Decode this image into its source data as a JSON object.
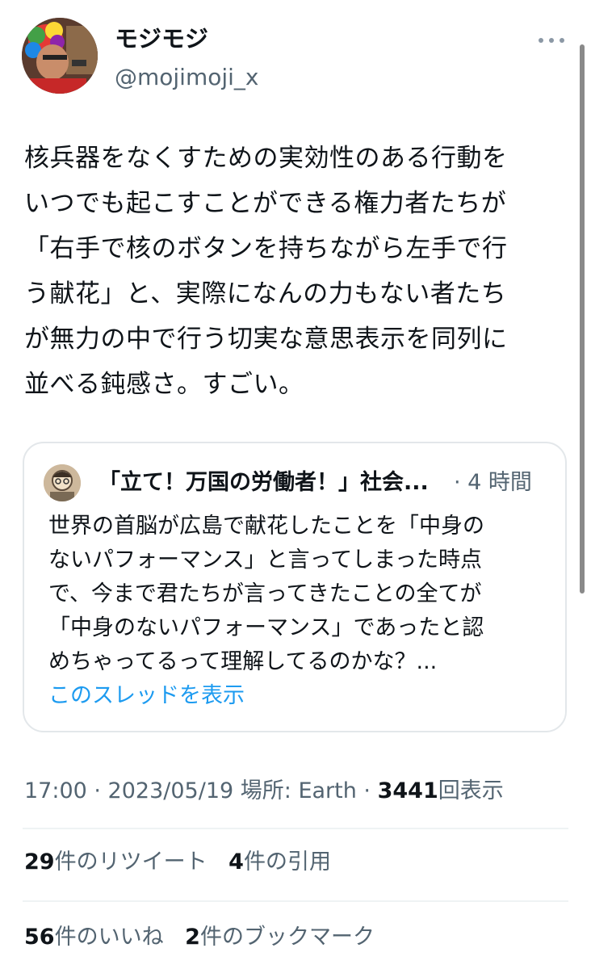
{
  "author": {
    "display_name": "モジモジ",
    "handle": "@mojimoji_x"
  },
  "tweet": {
    "lines": [
      "核兵器をなくすための実効性のある行動を",
      "いつでも起こすことができる権力者たちが",
      "「右手で核のボタンを持ちながら左手で行",
      "う献花」と、実際になんの力もない者たち",
      "が無力の中で行う切実な意思表示を同列に",
      "並べる鈍感さ。すごい。"
    ]
  },
  "quote": {
    "author_name": "「立て！万国の労働者！」社会...",
    "meta": "· 4 時間",
    "lines": [
      "世界の首脳が広島で献花したことを「中身の",
      "ないパフォーマンス」と言ってしまった時点",
      "で、今まで君たちが言ってきたことの全てが",
      "「中身のないパフォーマンス」であったと認",
      "めちゃってるって理解してるのかな？..."
    ],
    "show_thread": "このスレッドを表示"
  },
  "meta": {
    "time": "17:00 · 2023/05/19 場所: Earth · ",
    "views_count": "3441",
    "views_label": "回表示"
  },
  "stats": {
    "retweets_count": "29",
    "retweets_label": "件のリツイート",
    "quotes_count": "4",
    "quotes_label": "件の引用",
    "likes_count": "56",
    "likes_label": "件のいいね",
    "bookmarks_count": "2",
    "bookmarks_label": "件のブックマーク"
  },
  "icons": {
    "more": "more-horizontal-icon"
  },
  "colors": {
    "link": "#1d9bf0",
    "secondary_text": "#536471",
    "border": "#e3e7ea"
  }
}
